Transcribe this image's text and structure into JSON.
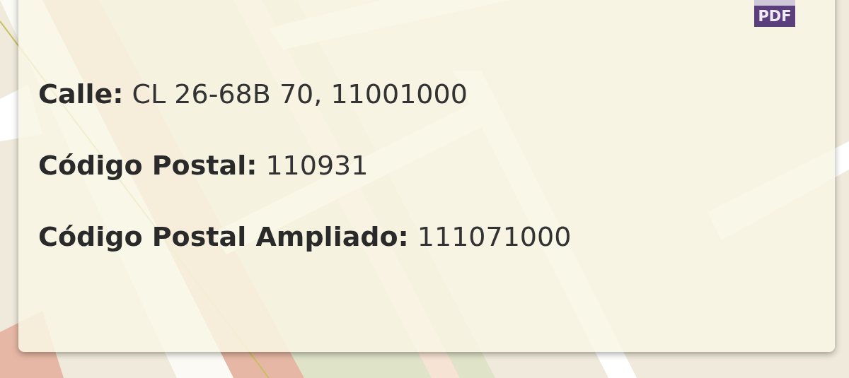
{
  "popup": {
    "pdf_icon": {
      "label": "PDF"
    },
    "fields": [
      {
        "label": "Calle:",
        "value": "CL 26-68B 70, 11001000"
      },
      {
        "label": "Código Postal:",
        "value": "110931"
      },
      {
        "label": "Código Postal Ampliado:",
        "value": "111071000"
      }
    ]
  }
}
